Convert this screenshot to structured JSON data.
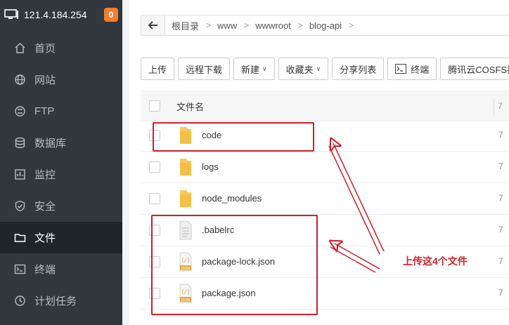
{
  "server": {
    "ip": "121.4.184.254",
    "badge": "0"
  },
  "sidebar": {
    "items": [
      {
        "label": "首页",
        "icon": "home-icon"
      },
      {
        "label": "网站",
        "icon": "globe-icon"
      },
      {
        "label": "FTP",
        "icon": "ftp-icon"
      },
      {
        "label": "数据库",
        "icon": "database-icon"
      },
      {
        "label": "监控",
        "icon": "monitor-icon"
      },
      {
        "label": "安全",
        "icon": "shield-icon"
      },
      {
        "label": "文件",
        "icon": "folder-icon",
        "active": true
      },
      {
        "label": "终端",
        "icon": "terminal-icon"
      },
      {
        "label": "计划任务",
        "icon": "clock-icon"
      }
    ]
  },
  "breadcrumb": [
    "根目录",
    "www",
    "wwwroot",
    "blog-api"
  ],
  "toolbar": {
    "upload": "上传",
    "remote_download": "远程下载",
    "new": "新建",
    "favorites": "收藏夹",
    "share_list": "分享列表",
    "terminal": "终端",
    "cosfs": "腾讯云COSFS挂"
  },
  "table": {
    "header_name": "文件名",
    "header_edge": "7",
    "files": [
      {
        "name": "code",
        "type": "folder"
      },
      {
        "name": "logs",
        "type": "folder"
      },
      {
        "name": "node_modules",
        "type": "folder"
      },
      {
        "name": ".babelrc",
        "type": "file"
      },
      {
        "name": "package-lock.json",
        "type": "json"
      },
      {
        "name": "package.json",
        "type": "json"
      }
    ],
    "edge_value": "7"
  },
  "annotation": {
    "text": "上传这4个文件",
    "color": "#d0202a"
  },
  "colors": {
    "sidebar_bg": "#32373d",
    "sidebar_active": "#20252b",
    "badge": "#f0802f",
    "folder": "#f7c95c",
    "annotation": "#d0202a"
  }
}
